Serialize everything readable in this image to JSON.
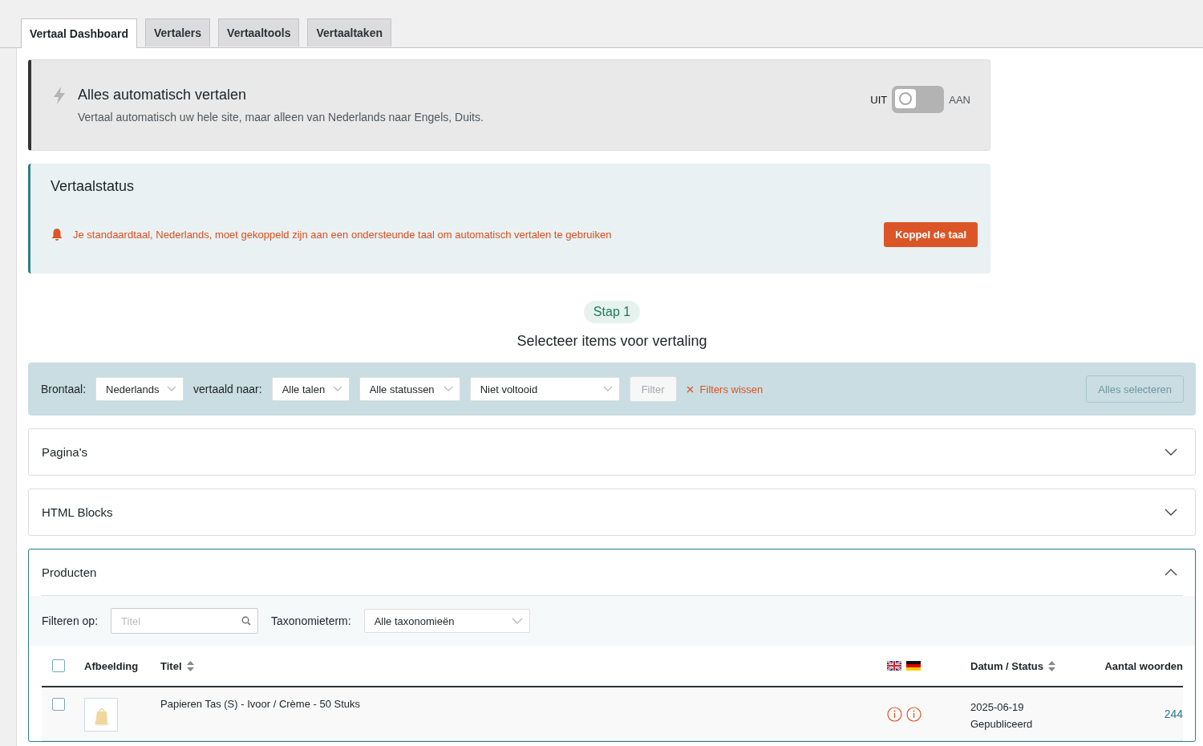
{
  "tabs": [
    {
      "label": "Vertaal Dashboard",
      "selected": true
    },
    {
      "label": "Vertalers",
      "selected": false
    },
    {
      "label": "Vertaaltools",
      "selected": false
    },
    {
      "label": "Vertaaltaken",
      "selected": false
    }
  ],
  "auto_translate": {
    "title": "Alles automatisch vertalen",
    "description": "Vertaal automatisch uw hele site, maar alleen van Nederlands naar Engels, Duits.",
    "off_label": "UIT",
    "on_label": "AAN",
    "on": false
  },
  "status": {
    "title": "Vertaalstatus",
    "message": "Je standaardtaal, Nederlands, moet gekoppeld zijn aan een ondersteunde taal om automatisch vertalen te gebruiken",
    "button": "Koppel de taal"
  },
  "step": {
    "badge": "Stap 1",
    "title": "Selecteer items voor vertaling"
  },
  "filters": {
    "source_label": "Brontaal:",
    "source": "Nederlands",
    "target_label": "vertaald naar:",
    "target": "Alle talen",
    "status": "Alle statussen",
    "completion": "Niet voltooid",
    "filter_button": "Filter",
    "clear": "Filters wissen",
    "select_all": "Alles selecteren"
  },
  "sections": [
    {
      "title": "Pagina's",
      "expanded": false
    },
    {
      "title": "HTML Blocks",
      "expanded": false
    },
    {
      "title": "Producten",
      "expanded": true,
      "filter_label": "Filteren op:",
      "search_placeholder": "Titel",
      "taxonomy_label": "Taxonomieterm:",
      "taxonomy": "Alle taxonomieën",
      "columns": [
        {
          "kind": "check",
          "checked": false
        },
        {
          "kind": "text",
          "label": "Afbeelding",
          "sortable": false
        },
        {
          "kind": "text",
          "label": "Titel",
          "sortable": true
        },
        {
          "kind": "flags"
        },
        {
          "kind": "text",
          "label": "Datum / Status",
          "sortable": true
        },
        {
          "kind": "text",
          "label": "Aantal woorden",
          "sortable": false
        }
      ],
      "rows": [
        {
          "checked": false,
          "title": "Papieren Tas (S) - Ivoor / Crème - 50 Stuks",
          "date": "2025-06-19",
          "status": "Gepubliceerd",
          "words": "244"
        }
      ]
    }
  ]
}
